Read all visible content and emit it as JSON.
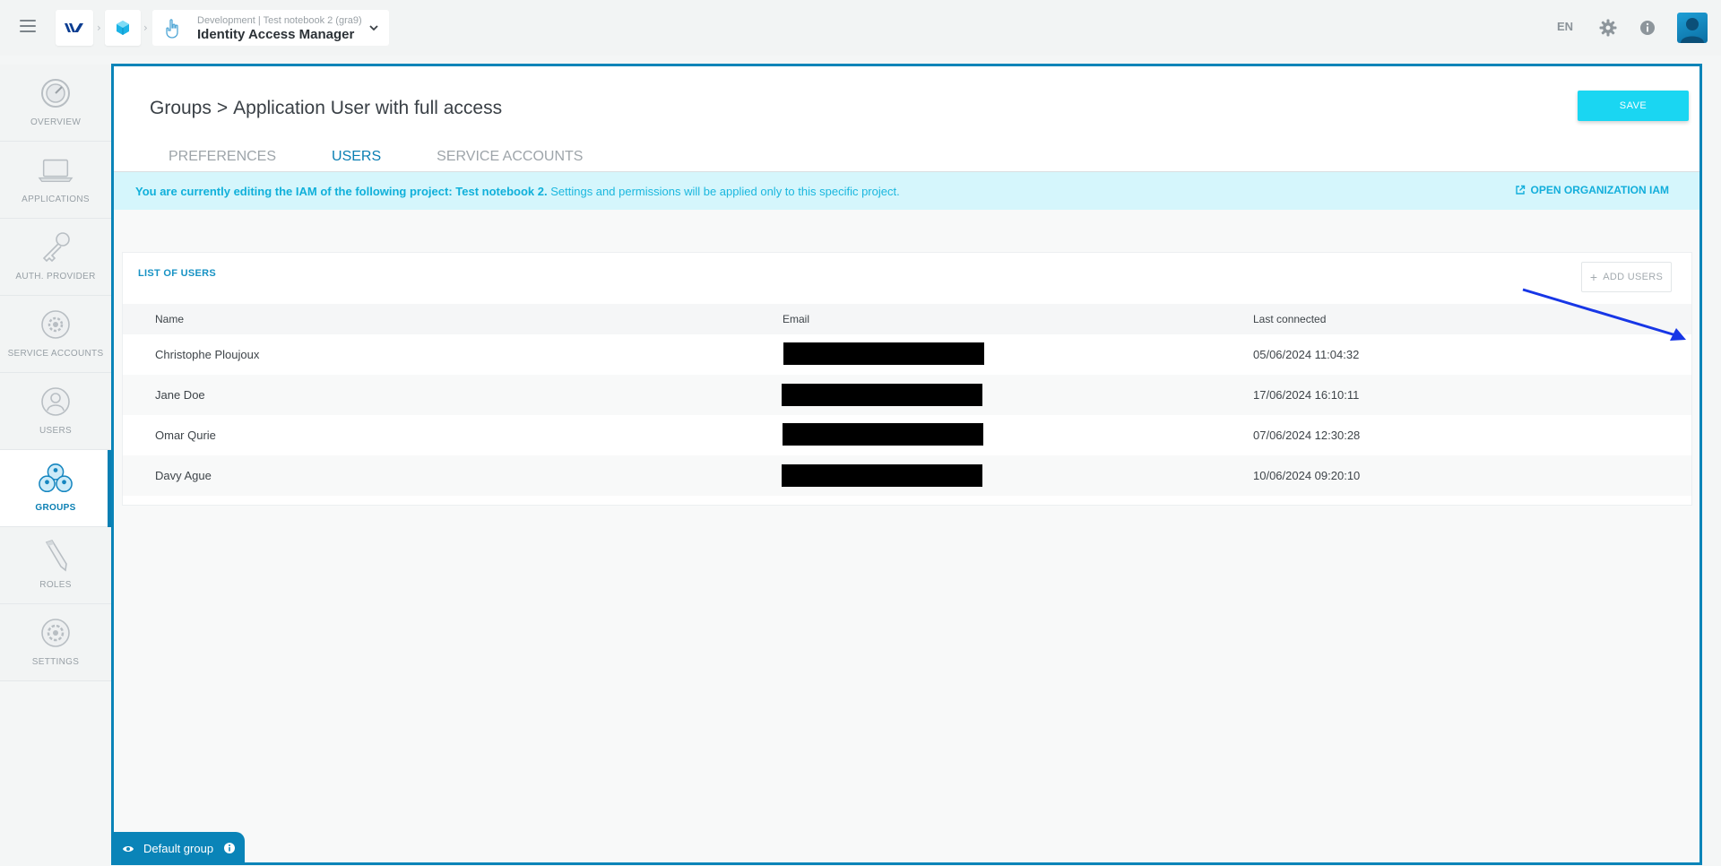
{
  "topbar": {
    "context_text": "Development | Test notebook 2 (gra9)",
    "app_name": "Identity Access Manager",
    "language": "EN"
  },
  "sidenav": {
    "items": [
      {
        "label": "OVERVIEW",
        "icon": "overview-icon"
      },
      {
        "label": "APPLICATIONS",
        "icon": "laptop-icon"
      },
      {
        "label": "AUTH. PROVIDER",
        "icon": "key-icon"
      },
      {
        "label": "SERVICE ACCOUNTS",
        "icon": "gear-badge-icon"
      },
      {
        "label": "USERS",
        "icon": "user-icon"
      },
      {
        "label": "GROUPS",
        "icon": "group-icon",
        "active": true
      },
      {
        "label": "ROLES",
        "icon": "pencil-icon"
      },
      {
        "label": "SETTINGS",
        "icon": "settings-icon"
      }
    ]
  },
  "page": {
    "breadcrumb_parent": "Groups",
    "breadcrumb_separator": ">",
    "title": "Application User with full access",
    "save_label": "SAVE"
  },
  "tabs": [
    {
      "label": "PREFERENCES",
      "active": false
    },
    {
      "label": "USERS",
      "active": true
    },
    {
      "label": "SERVICE ACCOUNTS",
      "active": false
    }
  ],
  "banner": {
    "bold_text": "You are currently editing the IAM of the following project: Test notebook 2.",
    "text": " Settings and permissions will be applied only to this specific project.",
    "link_label": "OPEN ORGANIZATION IAM"
  },
  "users_card": {
    "title": "LIST OF USERS",
    "add_label": "ADD USERS",
    "columns": [
      "Name",
      "Email",
      "Last connected"
    ],
    "rows": [
      {
        "name": "Christophe Ploujoux",
        "last": "05/06/2024 11:04:32"
      },
      {
        "name": "Jane Doe",
        "last": "17/06/2024 16:10:11"
      },
      {
        "name": "Omar Qurie",
        "last": "07/06/2024 12:30:28"
      },
      {
        "name": "Davy Ague",
        "last": "10/06/2024 09:20:10"
      }
    ]
  },
  "footer": {
    "default_group_label": "Default group"
  },
  "colors": {
    "accent": "#0a84b8",
    "save_button": "#1ad6f2",
    "banner_bg": "#d5f6fc",
    "annotation_arrow": "#1736e6"
  }
}
